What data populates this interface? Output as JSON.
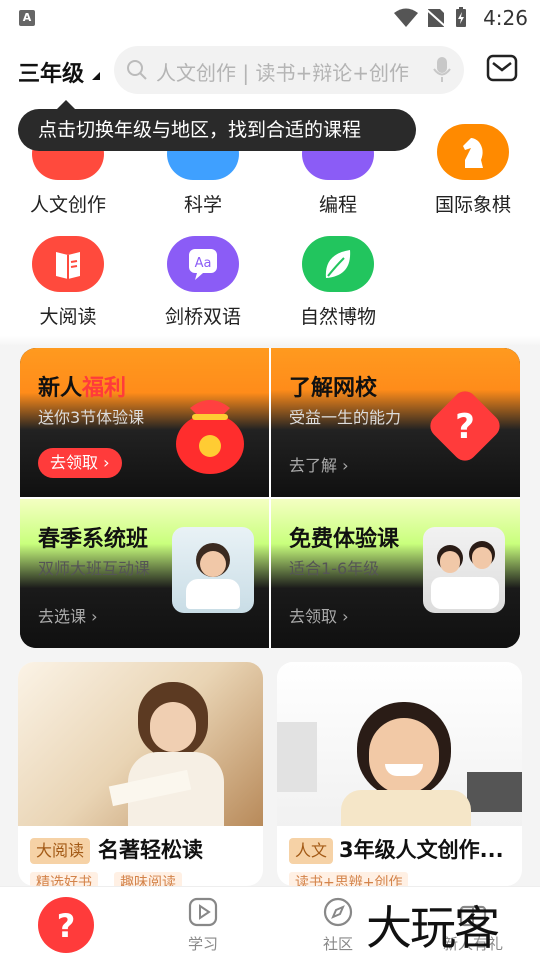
{
  "status_bar": {
    "time": "4:26",
    "notification_icon_letter": "A"
  },
  "header": {
    "grade": "三年级",
    "search_placeholder": "人文创作 | 读书+辩论+创作"
  },
  "tooltip": {
    "text": "点击切换年级与地区，找到合适的课程"
  },
  "categories": [
    {
      "label": "人文创作",
      "color": "#ff4a3d",
      "icon": "writing-icon"
    },
    {
      "label": "科学",
      "color": "#3fa0ff",
      "icon": "science-icon"
    },
    {
      "label": "编程",
      "color": "#8b5cf6",
      "icon": "coding-icon"
    },
    {
      "label": "国际象棋",
      "color": "#ff8a00",
      "icon": "chess-knight-icon"
    },
    {
      "label": "大阅读",
      "color": "#ff4a3d",
      "icon": "book-icon"
    },
    {
      "label": "剑桥双语",
      "color": "#8b5cf6",
      "icon": "bilingual-icon"
    },
    {
      "label": "自然博物",
      "color": "#22c55e",
      "icon": "leaf-icon"
    }
  ],
  "promos": [
    {
      "title_a": "新人",
      "title_b": "福利",
      "sub": "送你3节体验课",
      "cta": "去领取"
    },
    {
      "title": "了解网校",
      "sub": "受益一生的能力",
      "cta": "去了解"
    },
    {
      "title": "春季系统班",
      "sub": "双师大班互动课",
      "cta": "去选课"
    },
    {
      "title": "免费体验课",
      "sub": "适合1-6年级",
      "cta": "去领取"
    }
  ],
  "courses": [
    {
      "tag": "大阅读",
      "title": "名著轻松读",
      "chips": [
        "精选好书",
        "趣味阅读"
      ]
    },
    {
      "tag": "人文",
      "title": "3年级人文创作...",
      "chips": [
        "读书+思辨+创作"
      ]
    }
  ],
  "tabs": [
    {
      "label": "",
      "icon": "home-logo-icon"
    },
    {
      "label": "学习",
      "icon": "play-icon"
    },
    {
      "label": "社区",
      "icon": "compass-icon"
    },
    {
      "label": "新人有礼",
      "icon": "gift-icon"
    }
  ],
  "watermark": "大玩客",
  "colors": {
    "accent": "#ff3b3b",
    "tooltip_bg": "#2a2a2a"
  }
}
